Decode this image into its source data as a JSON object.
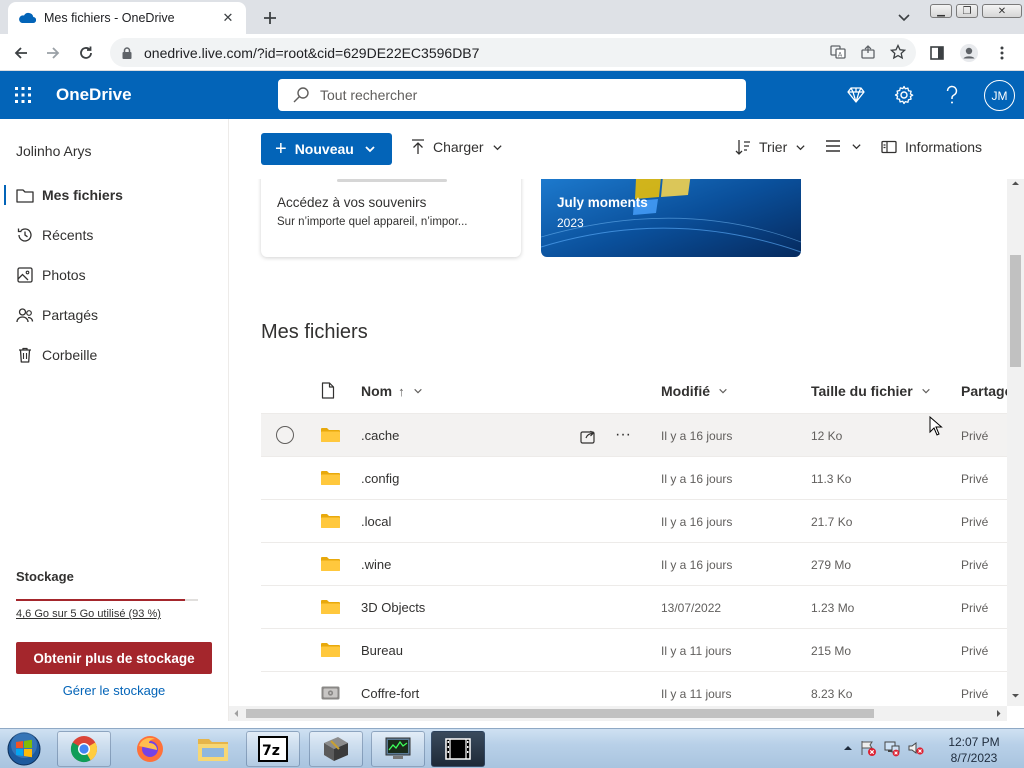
{
  "browser": {
    "tab_title": "Mes fichiers - OneDrive",
    "url": "onedrive.live.com/?id=root&cid=629DE22EC3596DB7"
  },
  "header": {
    "app_name": "OneDrive",
    "search_placeholder": "Tout rechercher",
    "avatar_initials": "JM",
    "accent": "#0364b8"
  },
  "sidebar": {
    "user_name": "Jolinho Arys",
    "items": [
      {
        "label": "Mes fichiers",
        "icon": "folder-icon",
        "active": true
      },
      {
        "label": "Récents",
        "icon": "history-icon"
      },
      {
        "label": "Photos",
        "icon": "photo-icon"
      },
      {
        "label": "Partagés",
        "icon": "people-icon"
      },
      {
        "label": "Corbeille",
        "icon": "trash-icon"
      }
    ],
    "storage": {
      "title": "Stockage",
      "usage_text": "4,6 Go sur 5 Go utilisé (93 %)",
      "used_fraction": 0.93,
      "get_more_label": "Obtenir plus de stockage",
      "manage_label": "Gérer le stockage",
      "warning_color": "#a4262c"
    }
  },
  "commands": {
    "new_label": "Nouveau",
    "upload_label": "Charger",
    "sort_label": "Trier",
    "info_label": "Informations"
  },
  "cards": [
    {
      "title": "Accédez à vos souvenirs",
      "subtitle": "Sur n’importe quel appareil, n’impor..."
    },
    {
      "title": "July moments",
      "subtitle": "2023"
    }
  ],
  "main": {
    "section_title": "Mes fichiers",
    "columns": {
      "name": "Nom",
      "sort_arrow": "↑",
      "modified": "Modifié",
      "size": "Taille du fichier",
      "sharing": "Partage"
    },
    "files": [
      {
        "name": ".cache",
        "modified": "Il y a 16 jours",
        "size": "12 Ko",
        "sharing": "Privé",
        "type": "folder"
      },
      {
        "name": ".config",
        "modified": "Il y a 16 jours",
        "size": "11.3 Ko",
        "sharing": "Privé",
        "type": "folder"
      },
      {
        "name": ".local",
        "modified": "Il y a 16 jours",
        "size": "21.7 Ko",
        "sharing": "Privé",
        "type": "folder"
      },
      {
        "name": ".wine",
        "modified": "Il y a 16 jours",
        "size": "279 Mo",
        "sharing": "Privé",
        "type": "folder"
      },
      {
        "name": "3D Objects",
        "modified": "13/07/2022",
        "size": "1.23 Mo",
        "sharing": "Privé",
        "type": "folder"
      },
      {
        "name": "Bureau",
        "modified": "Il y a 11 jours",
        "size": "215 Mo",
        "sharing": "Privé",
        "type": "folder"
      },
      {
        "name": "Coffre-fort",
        "modified": "Il y a 11 jours",
        "size": "8.23 Ko",
        "sharing": "Privé",
        "type": "vault"
      }
    ]
  },
  "taskbar": {
    "time": "12:07 PM",
    "date": "8/7/2023"
  }
}
